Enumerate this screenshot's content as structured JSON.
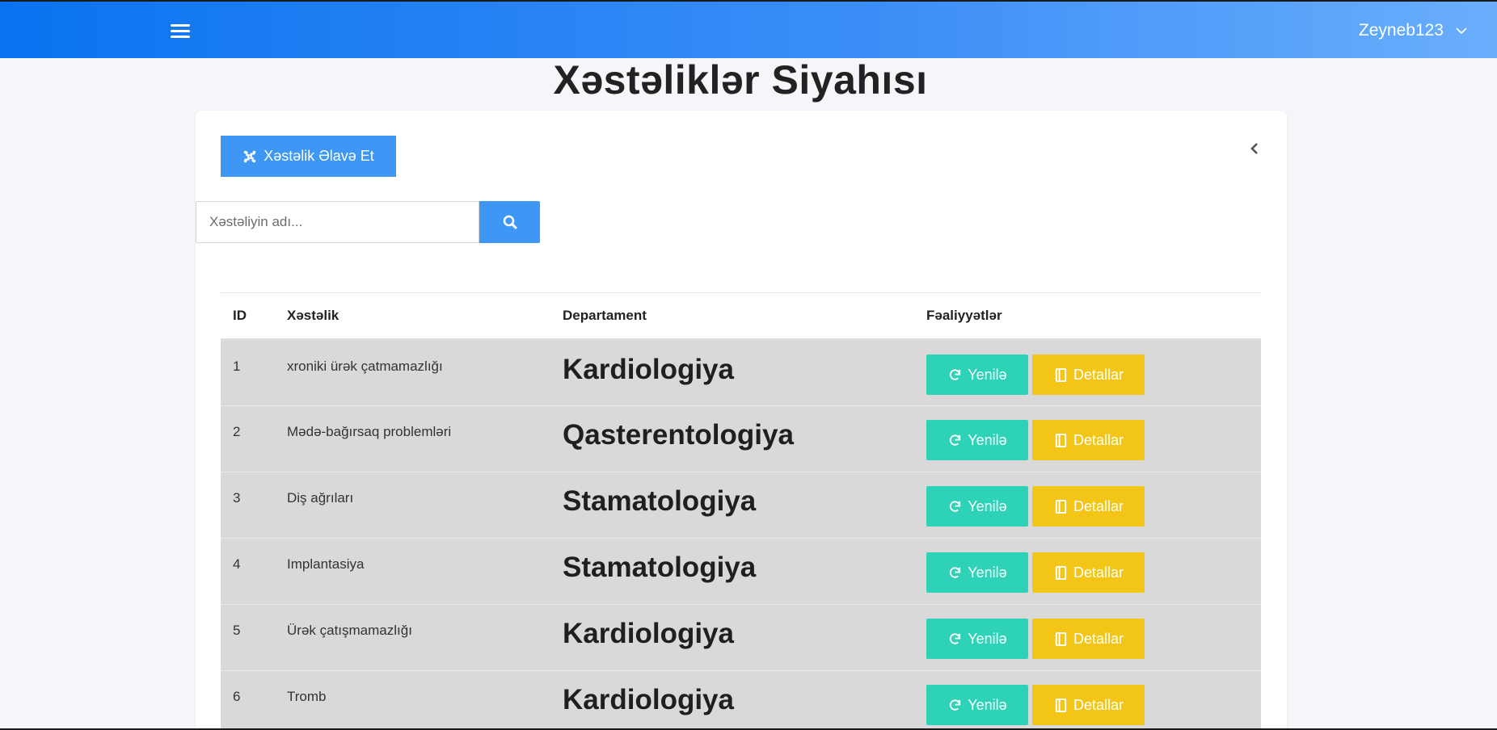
{
  "header": {
    "username": "Zeyneb123",
    "menu_icon": "hamburger-icon",
    "dropdown_icon": "chevron-down-icon",
    "gradient_colors": [
      "#0a73f0",
      "#6aaefc"
    ]
  },
  "page": {
    "title": "Xəstəliklər Siyahısı"
  },
  "toolbar": {
    "add_label": "Xəstəlik Əlavə Et",
    "add_icon": "joomla-icon",
    "collapse_icon": "chevron-left-icon"
  },
  "search": {
    "placeholder": "Xəstəliyin adı...",
    "value": "",
    "button_icon": "search-icon"
  },
  "table": {
    "columns": [
      "ID",
      "Xəstəlik",
      "Departament",
      "Fəaliyyətlər"
    ],
    "update_label": "Yenilə",
    "details_label": "Detallar",
    "rows": [
      {
        "id": "1",
        "name": "xroniki ürək çatmamazlığı",
        "department": "Kardiologiya"
      },
      {
        "id": "2",
        "name": "Mədə-bağırsaq problemləri",
        "department": "Qasterentologiya"
      },
      {
        "id": "3",
        "name": "Diş ağrıları",
        "department": "Stamatologiya"
      },
      {
        "id": "4",
        "name": "Implantasiya",
        "department": "Stamatologiya"
      },
      {
        "id": "5",
        "name": "Ürək çatışmamazlığı",
        "department": "Kardiologiya"
      },
      {
        "id": "6",
        "name": "Tromb",
        "department": "Kardiologiya"
      }
    ]
  },
  "colors": {
    "primary": "#3e97f5",
    "update": "#2ed3b7",
    "details": "#f2c516",
    "row_bg": "#d9d9d9"
  }
}
